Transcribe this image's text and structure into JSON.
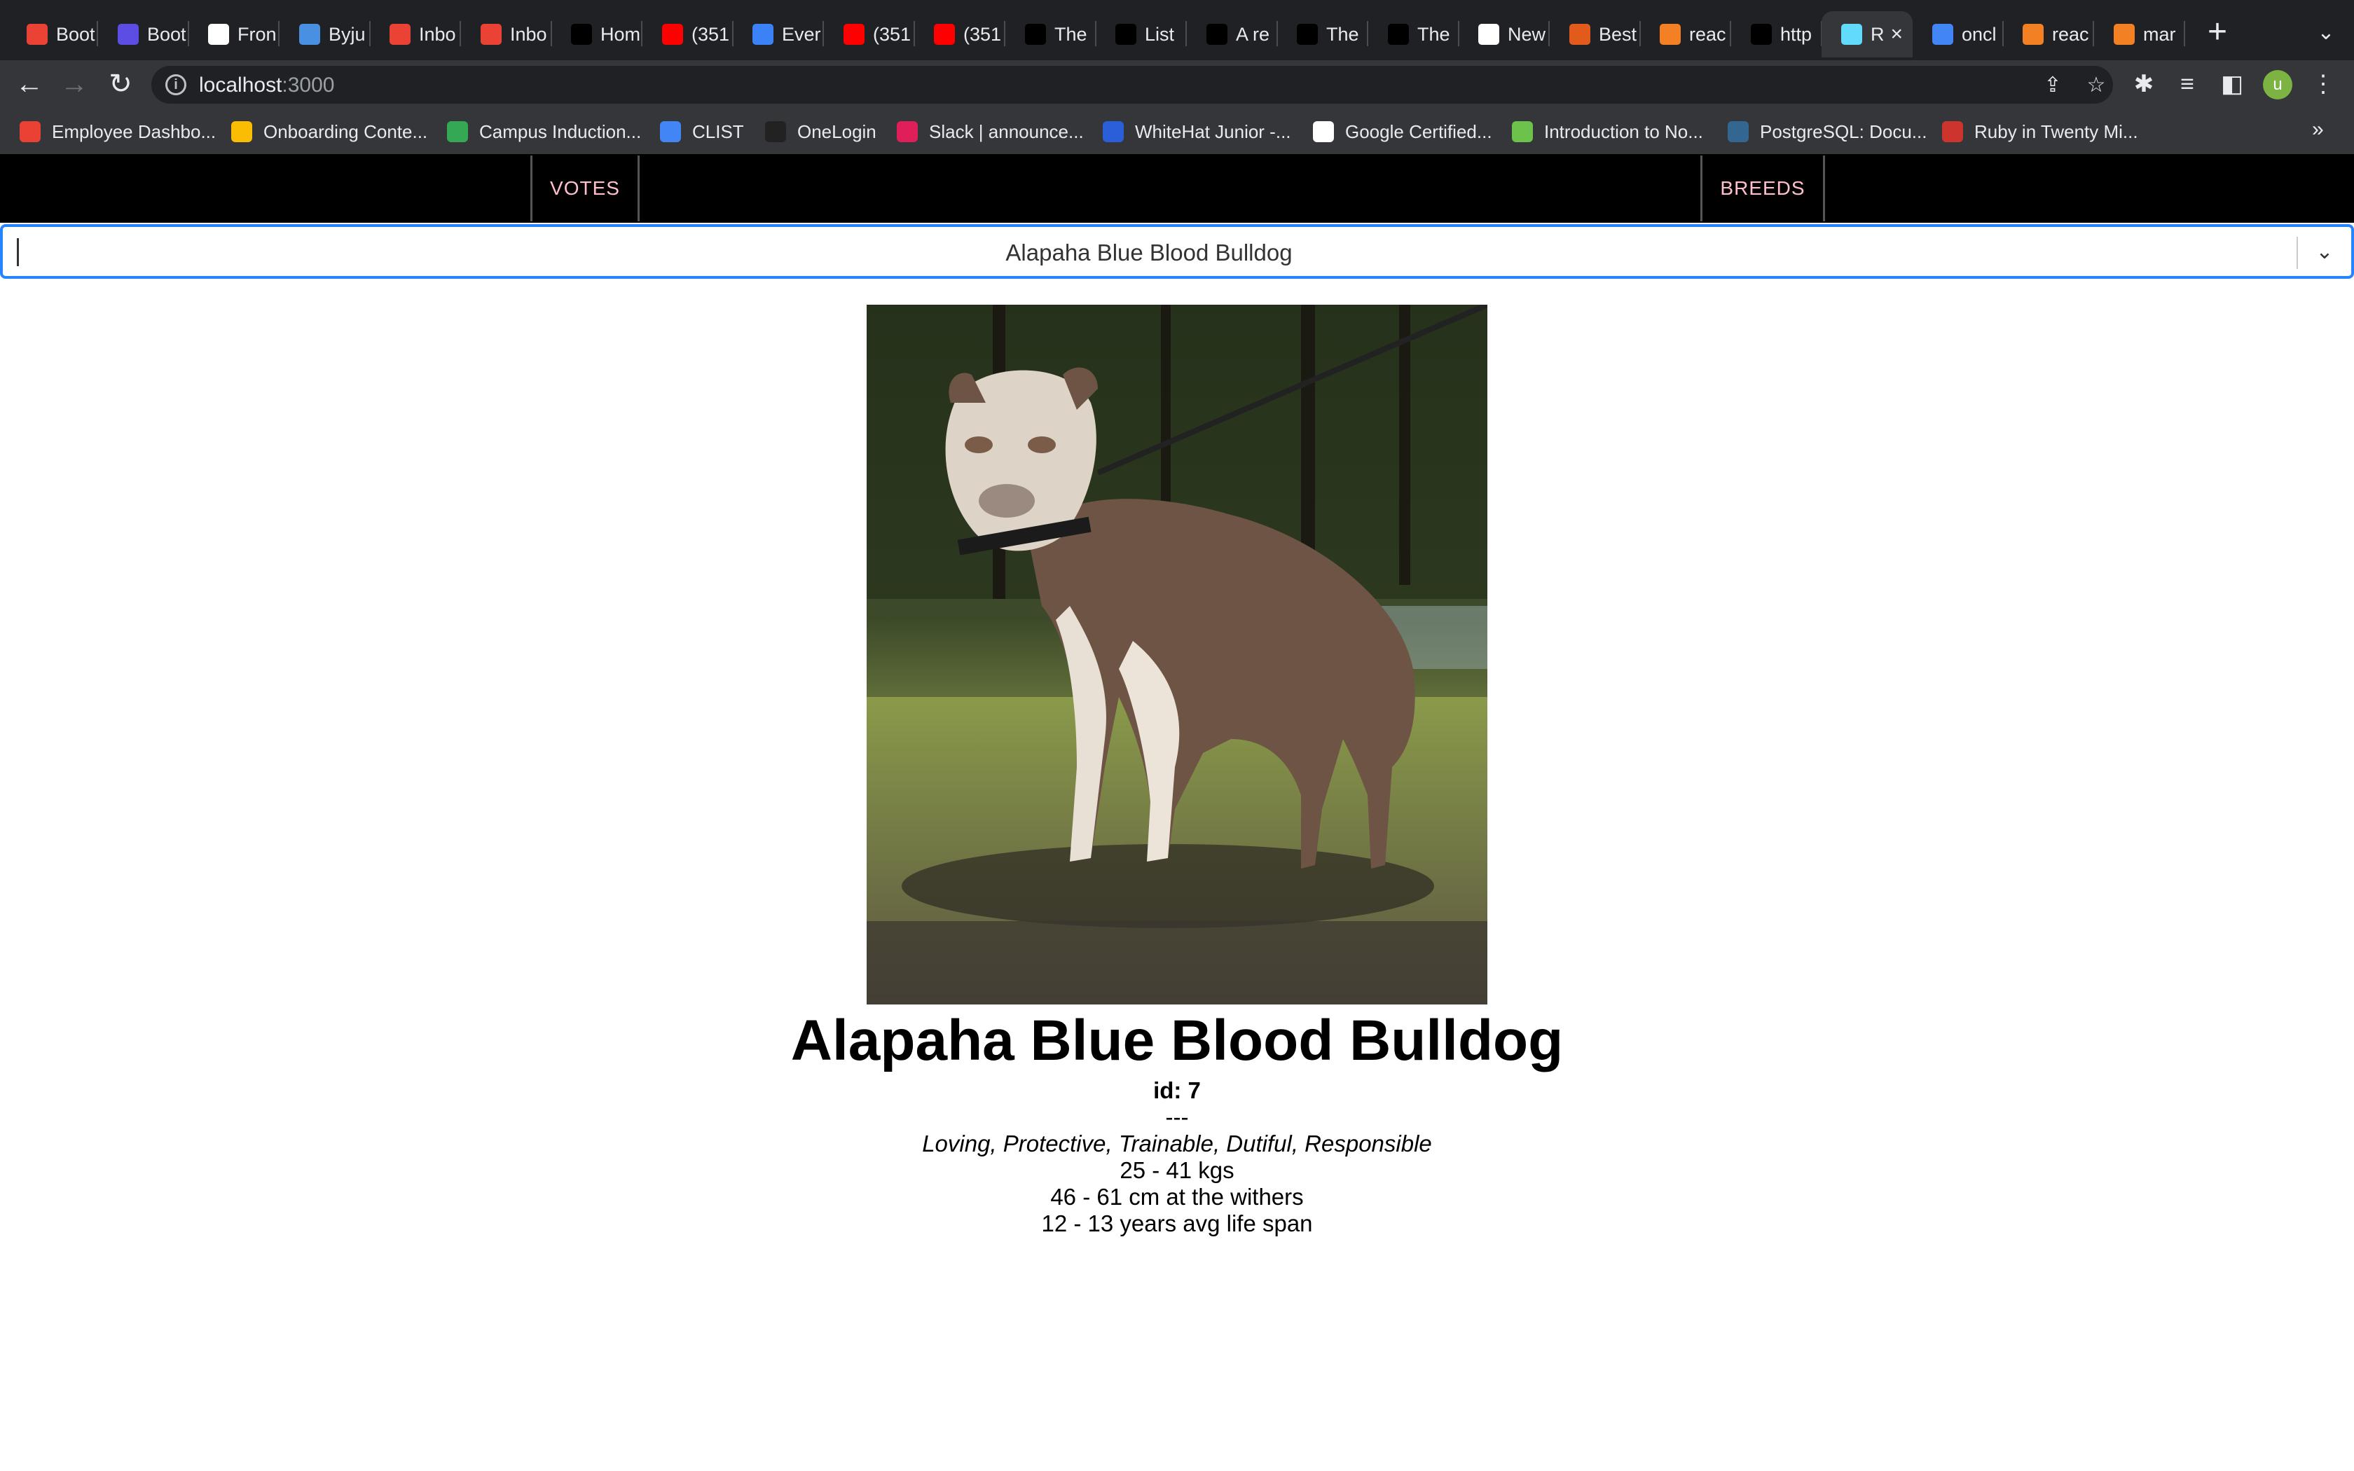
{
  "browser": {
    "tabs": [
      {
        "title": "Boot",
        "icon": "gmail-icon",
        "color": "#ea4335"
      },
      {
        "title": "Boot",
        "icon": "list-icon",
        "color": "#5c4ee5"
      },
      {
        "title": "Fron",
        "icon": "notion-icon",
        "color": "#ffffff"
      },
      {
        "title": "Byju",
        "icon": "byju-icon",
        "color": "#4a90e2"
      },
      {
        "title": "Inbo",
        "icon": "gmail-icon",
        "color": "#ea4335"
      },
      {
        "title": "Inbo",
        "icon": "gmail-icon",
        "color": "#ea4335"
      },
      {
        "title": "Hom",
        "icon": "dog-icon",
        "color": "#000000"
      },
      {
        "title": "(351",
        "icon": "youtube-icon",
        "color": "#ff0000"
      },
      {
        "title": "Ever",
        "icon": "ever-icon",
        "color": "#3b82f6"
      },
      {
        "title": "(351",
        "icon": "youtube-icon",
        "color": "#ff0000"
      },
      {
        "title": "(351",
        "icon": "youtube-icon",
        "color": "#ff0000"
      },
      {
        "title": "The",
        "icon": "dog-icon",
        "color": "#000000"
      },
      {
        "title": "List",
        "icon": "dog-icon",
        "color": "#000000"
      },
      {
        "title": "A re",
        "icon": "medium-icon",
        "color": "#000000"
      },
      {
        "title": "The",
        "icon": "dog-icon",
        "color": "#000000"
      },
      {
        "title": "The",
        "icon": "dog-icon",
        "color": "#000000"
      },
      {
        "title": "New",
        "icon": "github-icon",
        "color": "#ffffff"
      },
      {
        "title": "Best",
        "icon": "91-icon",
        "color": "#e25a1c"
      },
      {
        "title": "reac",
        "icon": "stackoverflow-icon",
        "color": "#f48024"
      },
      {
        "title": "http",
        "icon": "dog-icon",
        "color": "#000000"
      },
      {
        "title": "R",
        "icon": "react-icon",
        "color": "#61dafb",
        "active": true
      },
      {
        "title": "oncl",
        "icon": "google-icon",
        "color": "#4285f4"
      },
      {
        "title": "reac",
        "icon": "stackoverflow-icon",
        "color": "#f48024"
      },
      {
        "title": "mar",
        "icon": "stackoverflow-icon",
        "color": "#f48024"
      }
    ],
    "url_host": "localhost",
    "url_port": ":3000",
    "bookmarks": [
      {
        "label": "Employee Dashbo...",
        "color": "#e94235"
      },
      {
        "label": "Onboarding Conte...",
        "color": "#fbbc04"
      },
      {
        "label": "Campus Induction...",
        "color": "#34a853"
      },
      {
        "label": "CLIST",
        "color": "#4285f4"
      },
      {
        "label": "OneLogin",
        "color": "#222222"
      },
      {
        "label": "Slack | announce...",
        "color": "#e01e5a"
      },
      {
        "label": "WhiteHat Junior -...",
        "color": "#2b5fd9"
      },
      {
        "label": "Google Certified...",
        "color": "#ffffff"
      },
      {
        "label": "Introduction to No...",
        "color": "#6cc24a"
      },
      {
        "label": "PostgreSQL: Docu...",
        "color": "#336791"
      },
      {
        "label": "Ruby in Twenty Mi...",
        "color": "#cc342d"
      }
    ],
    "bookmarks_more": "»"
  },
  "app": {
    "nav": {
      "votes_label": "VOTES",
      "breeds_label": "BREEDS"
    },
    "breed_select": {
      "selected": "Alapaha Blue Blood Bulldog"
    },
    "breed": {
      "name": "Alapaha Blue Blood Bulldog",
      "id_line": "id: 7",
      "divider": "---",
      "temperament": "Loving, Protective, Trainable, Dutiful, Responsible",
      "weight": "25 - 41 kgs",
      "height": "46 - 61 cm at the withers",
      "life_span": "12 - 13 years avg life span"
    }
  },
  "colors": {
    "nav_text": "#ffc0cb",
    "select_focus": "#2684ff",
    "browser_bg": "#202124"
  }
}
